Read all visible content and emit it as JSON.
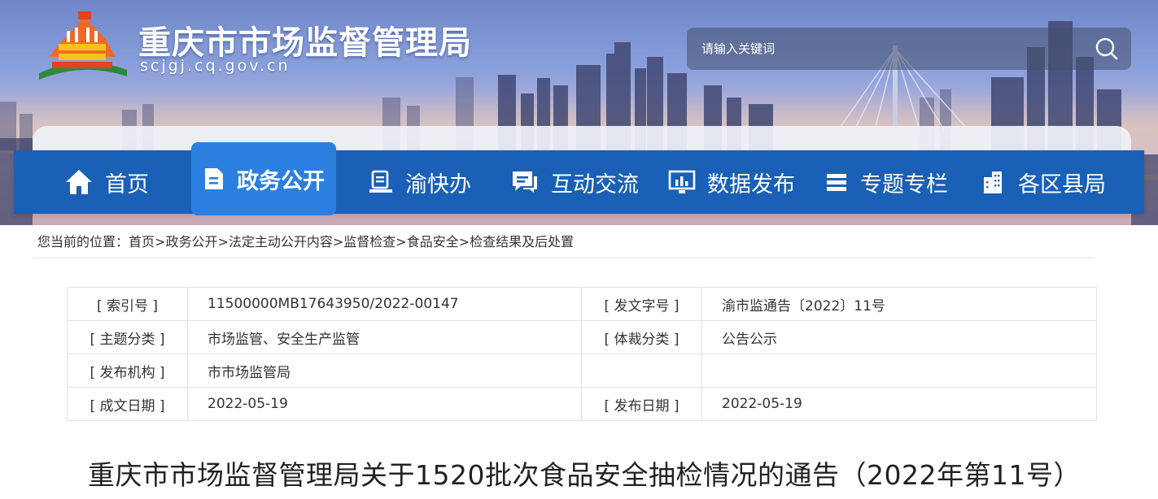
{
  "header": {
    "site_title": "重庆市市场监督管理局",
    "domain": "scjgj.cq.gov.cn",
    "search_placeholder": "请输入关键词"
  },
  "nav": {
    "items": [
      {
        "label": "首页",
        "icon": "home-icon"
      },
      {
        "label": "政务公开",
        "icon": "document-icon",
        "active": true
      },
      {
        "label": "渝快办",
        "icon": "desk-icon"
      },
      {
        "label": "互动交流",
        "icon": "chat-icon"
      },
      {
        "label": "数据发布",
        "icon": "chart-monitor-icon"
      },
      {
        "label": "专题专栏",
        "icon": "stack-icon"
      },
      {
        "label": "各区县局",
        "icon": "buildings-icon"
      }
    ]
  },
  "breadcrumb": {
    "prefix": "您当前的位置：",
    "items": [
      "首页",
      "政务公开",
      "法定主动公开内容",
      "监督检查",
      "食品安全",
      "检查结果及后处置"
    ],
    "separator": ">"
  },
  "meta": {
    "index_label": "[ 索引号 ]",
    "index_value": "11500000MB17643950/2022-00147",
    "doc_no_label": "[ 发文字号 ]",
    "doc_no_value": "渝市监通告〔2022〕11号",
    "topic_label": "[ 主题分类 ]",
    "topic_value": "市场监管、安全生产监管",
    "genre_label": "[ 体裁分类 ]",
    "genre_value": "公告公示",
    "issuer_label": "[ 发布机构 ]",
    "issuer_value": "市市场监管局",
    "written_label": "[ 成文日期 ]",
    "written_value": "2022-05-19",
    "published_label": "[ 发布日期 ]",
    "published_value": "2022-05-19"
  },
  "article": {
    "title": "重庆市市场监督管理局关于1520批次食品安全抽检情况的通告（2022年第11号）"
  },
  "colors": {
    "nav_bg": "#1960b6",
    "nav_active": "#2b7fde",
    "text": "#333333"
  }
}
